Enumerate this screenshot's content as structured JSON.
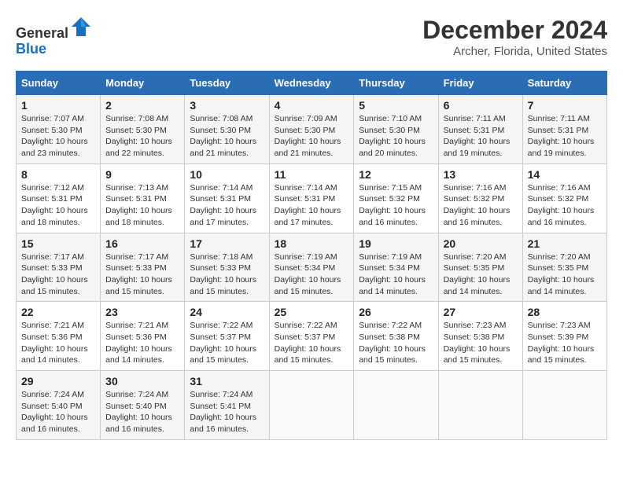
{
  "header": {
    "logo_line1": "General",
    "logo_line2": "Blue",
    "title": "December 2024",
    "subtitle": "Archer, Florida, United States"
  },
  "columns": [
    "Sunday",
    "Monday",
    "Tuesday",
    "Wednesday",
    "Thursday",
    "Friday",
    "Saturday"
  ],
  "weeks": [
    [
      {
        "day": "1",
        "info": "Sunrise: 7:07 AM\nSunset: 5:30 PM\nDaylight: 10 hours\nand 23 minutes."
      },
      {
        "day": "2",
        "info": "Sunrise: 7:08 AM\nSunset: 5:30 PM\nDaylight: 10 hours\nand 22 minutes."
      },
      {
        "day": "3",
        "info": "Sunrise: 7:08 AM\nSunset: 5:30 PM\nDaylight: 10 hours\nand 21 minutes."
      },
      {
        "day": "4",
        "info": "Sunrise: 7:09 AM\nSunset: 5:30 PM\nDaylight: 10 hours\nand 21 minutes."
      },
      {
        "day": "5",
        "info": "Sunrise: 7:10 AM\nSunset: 5:30 PM\nDaylight: 10 hours\nand 20 minutes."
      },
      {
        "day": "6",
        "info": "Sunrise: 7:11 AM\nSunset: 5:31 PM\nDaylight: 10 hours\nand 19 minutes."
      },
      {
        "day": "7",
        "info": "Sunrise: 7:11 AM\nSunset: 5:31 PM\nDaylight: 10 hours\nand 19 minutes."
      }
    ],
    [
      {
        "day": "8",
        "info": "Sunrise: 7:12 AM\nSunset: 5:31 PM\nDaylight: 10 hours\nand 18 minutes."
      },
      {
        "day": "9",
        "info": "Sunrise: 7:13 AM\nSunset: 5:31 PM\nDaylight: 10 hours\nand 18 minutes."
      },
      {
        "day": "10",
        "info": "Sunrise: 7:14 AM\nSunset: 5:31 PM\nDaylight: 10 hours\nand 17 minutes."
      },
      {
        "day": "11",
        "info": "Sunrise: 7:14 AM\nSunset: 5:31 PM\nDaylight: 10 hours\nand 17 minutes."
      },
      {
        "day": "12",
        "info": "Sunrise: 7:15 AM\nSunset: 5:32 PM\nDaylight: 10 hours\nand 16 minutes."
      },
      {
        "day": "13",
        "info": "Sunrise: 7:16 AM\nSunset: 5:32 PM\nDaylight: 10 hours\nand 16 minutes."
      },
      {
        "day": "14",
        "info": "Sunrise: 7:16 AM\nSunset: 5:32 PM\nDaylight: 10 hours\nand 16 minutes."
      }
    ],
    [
      {
        "day": "15",
        "info": "Sunrise: 7:17 AM\nSunset: 5:33 PM\nDaylight: 10 hours\nand 15 minutes."
      },
      {
        "day": "16",
        "info": "Sunrise: 7:17 AM\nSunset: 5:33 PM\nDaylight: 10 hours\nand 15 minutes."
      },
      {
        "day": "17",
        "info": "Sunrise: 7:18 AM\nSunset: 5:33 PM\nDaylight: 10 hours\nand 15 minutes."
      },
      {
        "day": "18",
        "info": "Sunrise: 7:19 AM\nSunset: 5:34 PM\nDaylight: 10 hours\nand 15 minutes."
      },
      {
        "day": "19",
        "info": "Sunrise: 7:19 AM\nSunset: 5:34 PM\nDaylight: 10 hours\nand 14 minutes."
      },
      {
        "day": "20",
        "info": "Sunrise: 7:20 AM\nSunset: 5:35 PM\nDaylight: 10 hours\nand 14 minutes."
      },
      {
        "day": "21",
        "info": "Sunrise: 7:20 AM\nSunset: 5:35 PM\nDaylight: 10 hours\nand 14 minutes."
      }
    ],
    [
      {
        "day": "22",
        "info": "Sunrise: 7:21 AM\nSunset: 5:36 PM\nDaylight: 10 hours\nand 14 minutes."
      },
      {
        "day": "23",
        "info": "Sunrise: 7:21 AM\nSunset: 5:36 PM\nDaylight: 10 hours\nand 14 minutes."
      },
      {
        "day": "24",
        "info": "Sunrise: 7:22 AM\nSunset: 5:37 PM\nDaylight: 10 hours\nand 15 minutes."
      },
      {
        "day": "25",
        "info": "Sunrise: 7:22 AM\nSunset: 5:37 PM\nDaylight: 10 hours\nand 15 minutes."
      },
      {
        "day": "26",
        "info": "Sunrise: 7:22 AM\nSunset: 5:38 PM\nDaylight: 10 hours\nand 15 minutes."
      },
      {
        "day": "27",
        "info": "Sunrise: 7:23 AM\nSunset: 5:38 PM\nDaylight: 10 hours\nand 15 minutes."
      },
      {
        "day": "28",
        "info": "Sunrise: 7:23 AM\nSunset: 5:39 PM\nDaylight: 10 hours\nand 15 minutes."
      }
    ],
    [
      {
        "day": "29",
        "info": "Sunrise: 7:24 AM\nSunset: 5:40 PM\nDaylight: 10 hours\nand 16 minutes."
      },
      {
        "day": "30",
        "info": "Sunrise: 7:24 AM\nSunset: 5:40 PM\nDaylight: 10 hours\nand 16 minutes."
      },
      {
        "day": "31",
        "info": "Sunrise: 7:24 AM\nSunset: 5:41 PM\nDaylight: 10 hours\nand 16 minutes."
      },
      {
        "day": "",
        "info": ""
      },
      {
        "day": "",
        "info": ""
      },
      {
        "day": "",
        "info": ""
      },
      {
        "day": "",
        "info": ""
      }
    ]
  ]
}
